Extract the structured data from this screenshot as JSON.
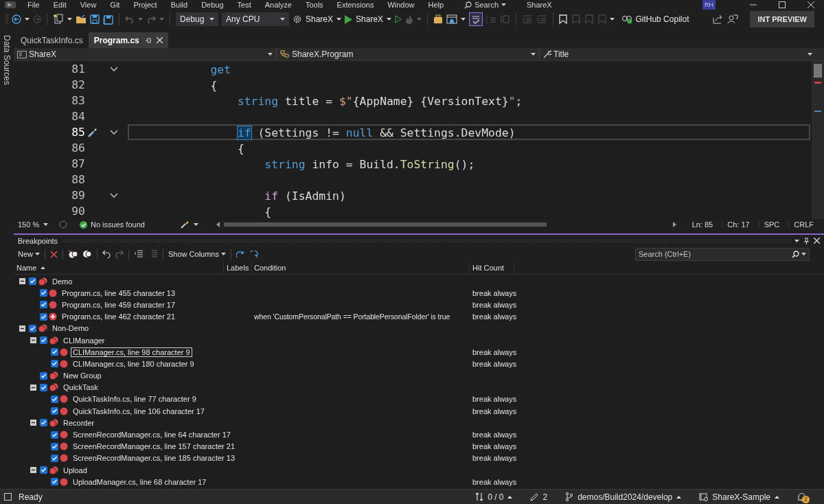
{
  "menu_bar": {
    "items": [
      "File",
      "Edit",
      "View",
      "Git",
      "Project",
      "Build",
      "Debug",
      "Test",
      "Analyze",
      "Tools",
      "Extensions",
      "Window",
      "Help"
    ],
    "search": "Search",
    "solution": "ShareX",
    "avatar": "RH"
  },
  "toolbar": {
    "configuration": "Debug",
    "platform": "Any CPU",
    "startup_project": "ShareX",
    "start_target": "ShareX",
    "spell_check_on": true,
    "copilot": "GitHub Copilot",
    "preview_badge": "INT PREVIEW"
  },
  "side_tab": "Data Sources",
  "tabs": [
    {
      "label": "QuickTaskInfo.cs",
      "selected": false
    },
    {
      "label": "Program.cs",
      "selected": true
    }
  ],
  "navigation": {
    "project": "ShareX",
    "type": "ShareX.Program",
    "member": "Title"
  },
  "code": {
    "lines": [
      {
        "number": "81",
        "fold": true,
        "current": false,
        "tokens": [
          {
            "kind": "keyword",
            "text": "get"
          }
        ]
      },
      {
        "number": "82",
        "fold": false,
        "current": false,
        "tokens": [
          {
            "kind": "text",
            "text": "{"
          }
        ]
      },
      {
        "number": "83",
        "fold": false,
        "current": false,
        "tokens": [
          {
            "kind": "keyword",
            "text": "string"
          },
          {
            "kind": "text",
            "text": " title = "
          },
          {
            "kind": "string",
            "text": "$\""
          },
          {
            "kind": "text",
            "text": "{AppName} {VersionText}"
          },
          {
            "kind": "string",
            "text": "\""
          },
          {
            "kind": "text",
            "text": ";"
          }
        ]
      },
      {
        "number": "84",
        "fold": false,
        "current": false
      },
      {
        "number": "85",
        "fold": true,
        "current": true,
        "tokens": [
          {
            "kind": "match",
            "text": "if"
          },
          {
            "kind": "text",
            "text": " (Settings != "
          },
          {
            "kind": "keyword",
            "text": "null"
          },
          {
            "kind": "text",
            "text": " && Settings.DevMode)"
          }
        ]
      },
      {
        "number": "86",
        "fold": false,
        "current": false,
        "tokens": [
          {
            "kind": "text",
            "text": "{"
          }
        ]
      },
      {
        "number": "87",
        "fold": false,
        "current": false,
        "tokens": [
          {
            "kind": "keyword",
            "text": "string"
          },
          {
            "kind": "text",
            "text": " info = Build."
          },
          {
            "kind": "method",
            "text": "ToString"
          },
          {
            "kind": "text",
            "text": "();"
          }
        ]
      },
      {
        "number": "88",
        "fold": false,
        "current": false
      },
      {
        "number": "89",
        "fold": true,
        "current": false,
        "tokens": [
          {
            "kind": "control",
            "text": "if"
          },
          {
            "kind": "text",
            "text": " (IsAdmin)"
          }
        ]
      },
      {
        "number": "90",
        "fold": false,
        "current": false,
        "tokens": [
          {
            "kind": "text",
            "text": "{"
          }
        ]
      }
    ]
  },
  "editor_status": {
    "zoom": "150 %",
    "issues": "No issues found",
    "line": "Ln: 85",
    "column": "Ch: 17",
    "whitespace": "SPC",
    "line_ending": "CRLF"
  },
  "breakpoints": {
    "title": "Breakpoints",
    "new_button": "New",
    "show_columns": "Show Columns",
    "search_placeholder": "Search (Ctrl+E)",
    "columns": [
      "Name",
      "Labels",
      "Condition",
      "Hit Count"
    ],
    "items": [
      {
        "name": "Demo",
        "kind": "group",
        "checked": true,
        "selected": false,
        "expanded": true,
        "children": [
          {
            "name": "Program.cs, line 455 character 13",
            "kind": "breakpoint",
            "checked": true,
            "selected": false,
            "hit_count": "break always"
          },
          {
            "name": "Program.cs, line 459 character 17",
            "kind": "breakpoint",
            "checked": true,
            "selected": false,
            "hit_count": "break always"
          },
          {
            "name": "Program.cs, line 462 character 21",
            "kind": "conditional",
            "checked": true,
            "selected": false,
            "condition": "when 'CustomPersonalPath == PortablePersonalFolder' is true",
            "hit_count": "break always"
          }
        ]
      },
      {
        "name": "Non-Demo",
        "kind": "group",
        "checked": true,
        "selected": false,
        "expanded": true,
        "children": [
          {
            "name": "CLIManager",
            "kind": "group",
            "checked": true,
            "selected": false,
            "expanded": true,
            "children": [
              {
                "name": "CLIManager.cs, line 98 character 9",
                "kind": "breakpoint",
                "checked": true,
                "selected": true,
                "hit_count": "break always"
              },
              {
                "name": "CLIManager.cs, line 180 character 9",
                "kind": "breakpoint",
                "checked": true,
                "selected": false,
                "hit_count": "break always"
              }
            ]
          },
          {
            "name": "New Group",
            "kind": "group",
            "checked": true,
            "selected": false
          },
          {
            "name": "QuickTask",
            "kind": "group",
            "checked": true,
            "selected": false,
            "expanded": true,
            "children": [
              {
                "name": "QuickTaskInfo.cs, line 77 character 9",
                "kind": "breakpoint",
                "checked": true,
                "selected": false,
                "hit_count": "break always"
              },
              {
                "name": "QuickTaskInfo.cs, line 106 character 17",
                "kind": "breakpoint",
                "checked": true,
                "selected": false,
                "hit_count": "break always"
              }
            ]
          },
          {
            "name": "Recorder",
            "kind": "group",
            "checked": true,
            "selected": false,
            "expanded": true,
            "children": [
              {
                "name": "ScreenRecordManager.cs, line 64 character 17",
                "kind": "breakpoint",
                "checked": true,
                "selected": false,
                "hit_count": "break always"
              },
              {
                "name": "ScreenRecordManager.cs, line 157 character 21",
                "kind": "breakpoint",
                "checked": true,
                "selected": false,
                "hit_count": "break always"
              },
              {
                "name": "ScreenRecordManager.cs, line 185 character 13",
                "kind": "breakpoint",
                "checked": true,
                "selected": false,
                "hit_count": "break always"
              }
            ]
          },
          {
            "name": "Upload",
            "kind": "group",
            "checked": true,
            "selected": false,
            "expanded": true,
            "children": [
              {
                "name": "UploadManager.cs, line 68 character 17",
                "kind": "breakpoint",
                "checked": true,
                "selected": false,
                "hit_count": "break always"
              }
            ]
          }
        ]
      }
    ]
  },
  "status_bar": {
    "status": "Ready",
    "changes": "0 / 0",
    "edits": "2",
    "branch": "demos/Build2024/develop",
    "repository": "ShareX-Sample",
    "notifications": "2"
  }
}
